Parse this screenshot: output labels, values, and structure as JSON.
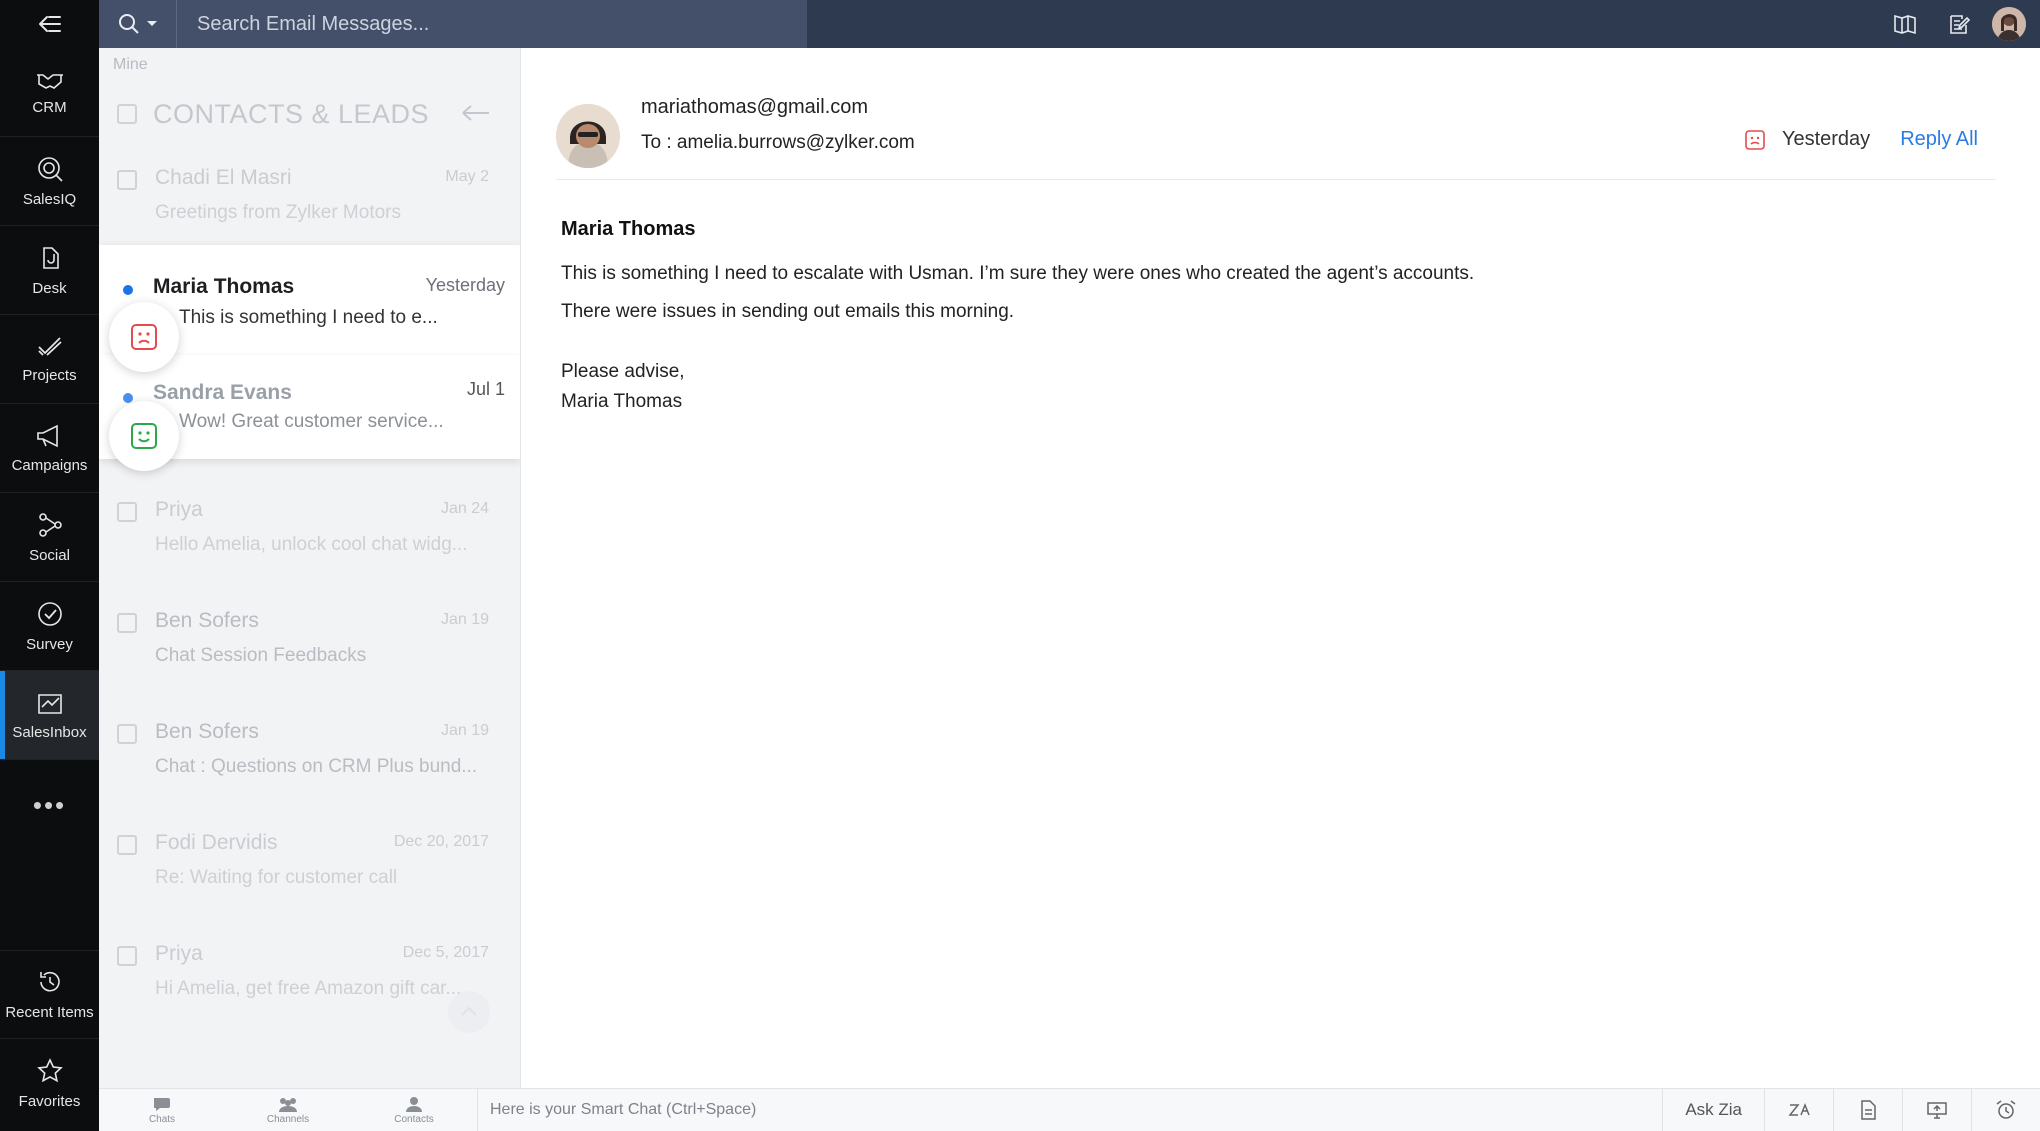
{
  "topbar": {
    "search_placeholder": "Search Email Messages..."
  },
  "sidebar": {
    "items": [
      {
        "label": "CRM",
        "icon": "handshake-icon"
      },
      {
        "label": "SalesIQ",
        "icon": "salesiq-icon"
      },
      {
        "label": "Desk",
        "icon": "desk-icon"
      },
      {
        "label": "Projects",
        "icon": "check-ticks-icon"
      },
      {
        "label": "Campaigns",
        "icon": "megaphone-icon"
      },
      {
        "label": "Social",
        "icon": "share-nodes-icon"
      },
      {
        "label": "Survey",
        "icon": "check-circle-icon"
      },
      {
        "label": "SalesInbox",
        "icon": "inbox-chart-icon",
        "active": true
      }
    ],
    "more": "•••",
    "bottom_items": [
      {
        "label": "Recent Items",
        "icon": "history-icon"
      },
      {
        "label": "Favorites",
        "icon": "star-icon"
      }
    ]
  },
  "list": {
    "filter_label": "Mine",
    "title": "CONTACTS & LEADS",
    "messages": [
      {
        "name": "Chadi El Masri",
        "date": "May 2",
        "preview": "Greetings from Zylker Motors"
      },
      {
        "name": "Maria Thomas",
        "date": "Yesterday",
        "preview": "This is something I need to e...",
        "sentiment": "negative"
      },
      {
        "name": "Sandra Evans",
        "date": "Jul 1",
        "preview": "Wow! Great customer service...",
        "sentiment": "positive"
      },
      {
        "name": "Priya",
        "date": "Jan 24",
        "preview": "Hello Amelia, unlock cool chat widg..."
      },
      {
        "name": "Ben Sofers",
        "date": "Jan 19",
        "preview": "Chat Session Feedbacks"
      },
      {
        "name": "Ben Sofers",
        "date": "Jan 19",
        "preview": "Chat : Questions on CRM Plus bund..."
      },
      {
        "name": "Fodi Dervidis",
        "date": "Dec 20, 2017",
        "preview": "Re: Waiting for customer call"
      },
      {
        "name": "Priya",
        "date": "Dec 5, 2017",
        "preview": "Hi Amelia, get free Amazon gift car..."
      }
    ]
  },
  "reader": {
    "from": "mariathomas@gmail.com",
    "to": "To : amelia.burrows@zylker.com",
    "when": "Yesterday",
    "reply_all": "Reply All",
    "body_name": "Maria Thomas",
    "body_line1": "This is something I need to escalate with Usman. I’m sure they were ones who created the agent’s accounts.",
    "body_line2": "There were issues in sending out emails this morning.",
    "sign1": "Please advise,",
    "sign2": "Maria Thomas"
  },
  "bottombar": {
    "tabs": [
      "Chats",
      "Channels",
      "Contacts"
    ],
    "smart_chat": "Here is your Smart Chat (Ctrl+Space)",
    "ask_zia": "Ask Zia"
  },
  "colors": {
    "sidebar_bg": "#0c0d0f",
    "topbar_bg": "#2e3a4f",
    "accent_blue": "#2a7be4",
    "negative_red": "#e64a4a",
    "positive_green": "#2aa84a"
  }
}
